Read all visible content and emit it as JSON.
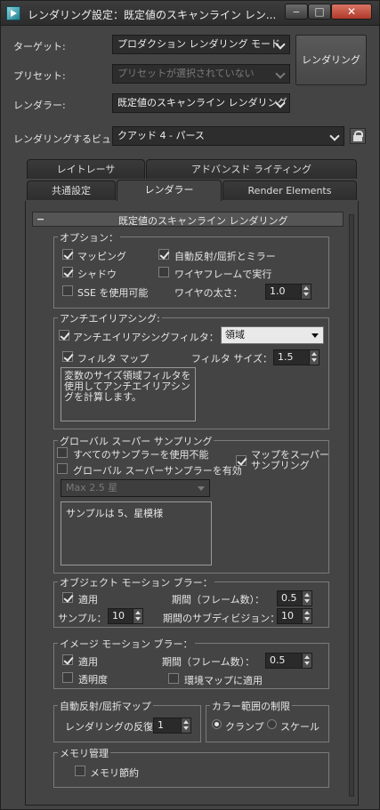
{
  "window": {
    "title": "レンダリング設定：既定値のスキャンライン レン...",
    "buttons": {
      "minimize": "‒",
      "maximize": "□",
      "close": "✕"
    }
  },
  "header": {
    "target_label": "ターゲット:",
    "target_value": "プロダクション レンダリング モード",
    "preset_label": "プリセット:",
    "preset_value": "プリセットが選択されていない",
    "renderer_label": "レンダラー:",
    "renderer_value": "既定値のスキャンライン レンダリング",
    "view_label": "レンダリングするビュー:",
    "view_value": "クアッド 4 - パース",
    "render_button": "レンダリング"
  },
  "tabs": {
    "row1": [
      "レイトレーサ",
      "アドバンスド ライティング"
    ],
    "row2": [
      "共通設定",
      "レンダラー",
      "Render Elements"
    ],
    "active": "レンダラー"
  },
  "rollout": {
    "toggle": "−",
    "title": "既定値のスキャンライン レンダリング"
  },
  "options": {
    "title": "オプション：",
    "mapping": "マッピング",
    "auto_reflect": "自動反射/屈折とミラー",
    "shadow": "シャドウ",
    "wireframe": "ワイヤフレームで実行",
    "sse": "SSE を使用可能",
    "wire_thickness_label": "ワイヤの太さ：",
    "wire_thickness_value": "1.0"
  },
  "antialias": {
    "title": "アンチエイリアシング:",
    "enable": "アンチエイリアシング",
    "filter_label": "フィルタ：",
    "filter_value": "領域",
    "filter_maps": "フィルタ マップ",
    "filter_size_label": "フィルタ サイズ：",
    "filter_size_value": "1.5",
    "description": "変数のサイズ領域フィルタを使用してアンチエイリアシングを計算します。"
  },
  "global_supersampling": {
    "title": "グローバル スーパー サンプリング",
    "disable_all": "すべてのサンプラーを使用不能",
    "enable_global": "グローバル スーパーサンプラーを有効",
    "supersample_maps": "マップをスーパーサンプリング",
    "sampler_value": "Max 2.5 星",
    "info": "サンプルは 5、星模様"
  },
  "object_motion_blur": {
    "title": "オブジェクト モーション ブラー：",
    "apply": "適用",
    "duration_label": "期間（フレーム数）：",
    "duration_value": "0.5",
    "samples_label": "サンプル：",
    "samples_value": "10",
    "subdiv_label": "期間のサブディビジョン：",
    "subdiv_value": "10"
  },
  "image_motion_blur": {
    "title": "イメージ モーション ブラー：",
    "apply": "適用",
    "duration_label": "期間（フレーム数）：",
    "duration_value": "0.5",
    "transparency": "透明度",
    "env_map": "環境マップに適用"
  },
  "auto_reflect_map": {
    "title": "自動反射/屈折マップ",
    "iterations_label": "レンダリングの反復：",
    "iterations_value": "1"
  },
  "color_range": {
    "title": "カラー範囲の制限",
    "clamp": "クランプ",
    "scale": "スケール"
  },
  "memory": {
    "title": "メモリ管理",
    "conserve": "メモリ節約"
  }
}
